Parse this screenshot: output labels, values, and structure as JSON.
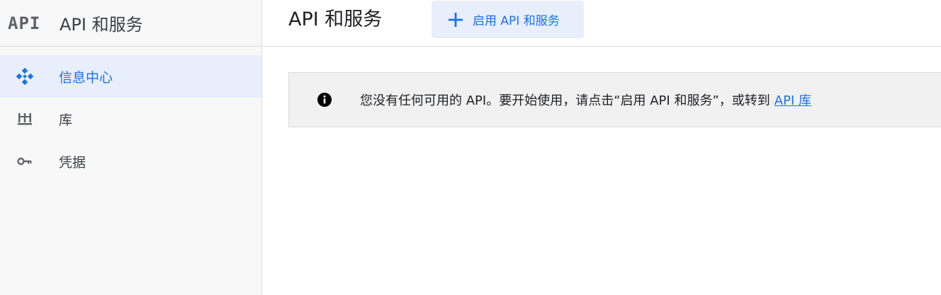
{
  "sidebar": {
    "logo_text": "API",
    "title": "API 和服务",
    "items": [
      {
        "label": "信息中心",
        "icon": "dashboard-diamond-icon",
        "active": true
      },
      {
        "label": "库",
        "icon": "library-icon",
        "active": false
      },
      {
        "label": "凭据",
        "icon": "key-icon",
        "active": false
      }
    ]
  },
  "header": {
    "title": "API 和服务",
    "enable_button_label": "启用 API 和服务"
  },
  "notice": {
    "icon": "info-icon",
    "message": "您没有任何可用的 API。要开始使用，请点击“启用 API 和服务”，或转到",
    "link_text": "API 库"
  },
  "colors": {
    "accent": "#1a73e8",
    "active_bg": "#e8eefb",
    "sidebar_bg": "#f8f8f8",
    "notice_bg": "#f1f1f1",
    "border": "#dadce0"
  }
}
